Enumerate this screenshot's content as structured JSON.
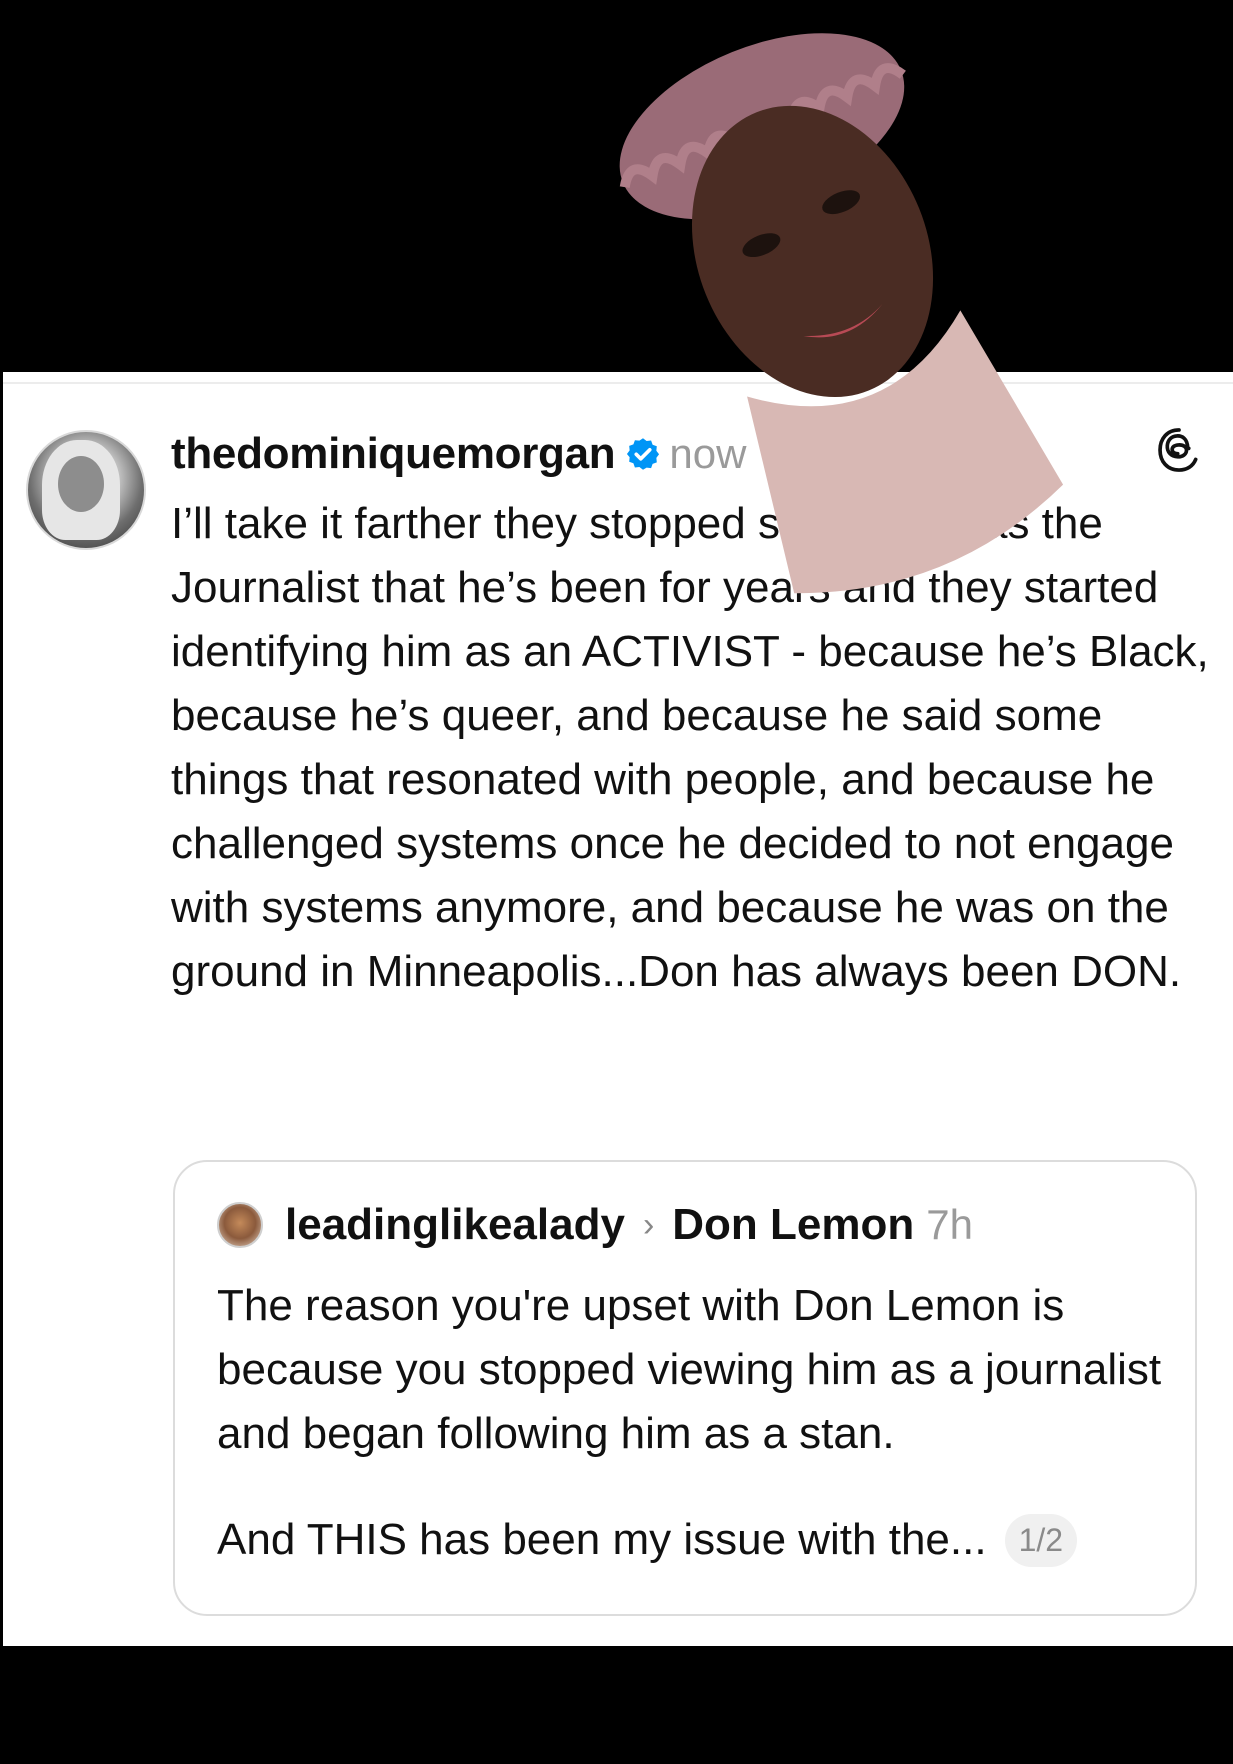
{
  "post": {
    "username": "thedominiquemorgan",
    "timestamp": "now",
    "text": "I’ll take it farther they stopped seeing him as the Journalist that he’s been for years and they started identifying him as an ACTIVIST - because he’s Black, because he’s queer, and because he said some things that resonated with people, and because he challenged systems once he decided to not engage with systems anymore, and because he was on the ground in Minneapolis...Don has always been DON."
  },
  "quote": {
    "username": "leadinglikealady",
    "target": "Don Lemon",
    "timestamp": "7h",
    "text": "The reason you're upset with Don Lemon is because you stopped viewing him as a journalist and began following him as a stan.",
    "more_text": "And THIS has been my issue with the...",
    "page_indicator": "1/2"
  },
  "icons": {
    "verified": "verified-badge-icon",
    "threads": "threads-logo-icon",
    "chevron": "chevron-right-icon"
  },
  "colors": {
    "background": "#000000",
    "card": "#ffffff",
    "text": "#111111",
    "muted": "#9a9a9a",
    "verified": "#0095f6"
  }
}
